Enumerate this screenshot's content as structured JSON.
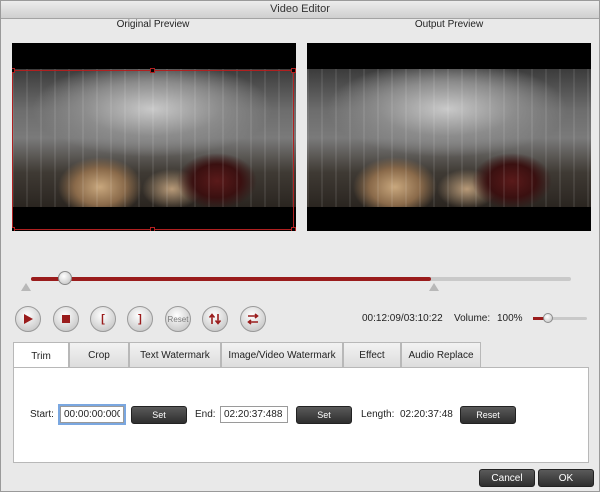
{
  "window": {
    "title": "Video Editor"
  },
  "preview": {
    "original_label": "Original Preview",
    "output_label": "Output Preview"
  },
  "timeline": {
    "progress_fraction": 0.067,
    "end_marker_fraction": 0.74
  },
  "controls": {
    "play_icon": "play-icon",
    "stop_icon": "stop-icon",
    "mark_in_label": "[",
    "mark_out_label": "]",
    "reset_label": "Reset",
    "flip_icon": "flip-vertical-icon",
    "rotate_icon": "rotate-icon",
    "accent": "#9a1c1c"
  },
  "time": {
    "current_total": "00:12:09/03:10:22",
    "volume_label": "Volume:",
    "volume_value": "100%"
  },
  "tabs": [
    "Trim",
    "Crop",
    "Text Watermark",
    "Image/Video Watermark",
    "Effect",
    "Audio Replace"
  ],
  "trim": {
    "start_label": "Start:",
    "start_value": "00:00:00:000",
    "set_label": "Set",
    "end_label": "End:",
    "end_value": "02:20:37:488",
    "length_label": "Length:",
    "length_value": "02:20:37:48",
    "reset_label": "Reset"
  },
  "footer": {
    "cancel_label": "Cancel",
    "ok_label": "OK"
  }
}
